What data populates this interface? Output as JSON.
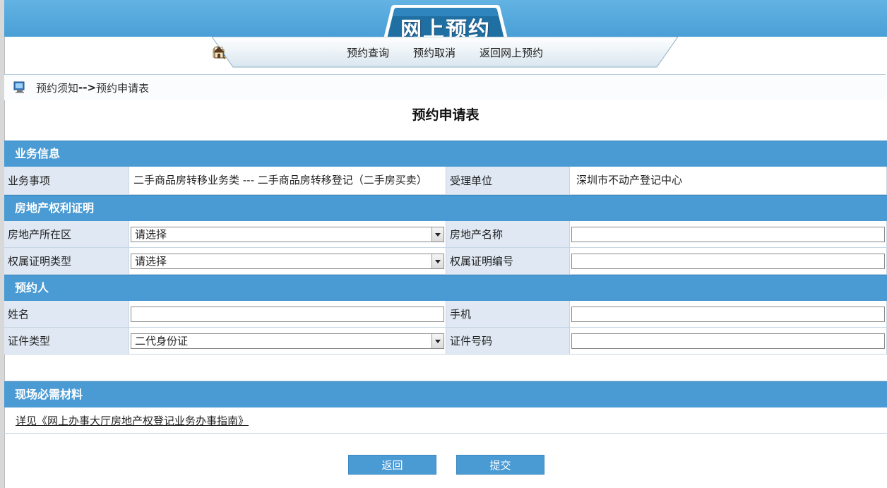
{
  "header": {
    "title": "网上预约",
    "nav": [
      {
        "icon": "search-icon",
        "label": "预约查询"
      },
      {
        "icon": "cancel-icon",
        "label": "预约取消"
      },
      {
        "icon": "home-icon",
        "label": "返回网上预约"
      }
    ]
  },
  "breadcrumb": {
    "parent": "预约须知",
    "separator": "-->",
    "current": "预约申请表"
  },
  "form_title": "预约申请表",
  "sections": {
    "business": {
      "title": "业务信息",
      "item_label": "业务事项",
      "item_value": "二手商品房转移业务类 --- 二手商品房转移登记（二手房买卖）",
      "office_label": "受理单位",
      "office_value": "深圳市不动产登记中心"
    },
    "property": {
      "title": "房地产权利证明",
      "district_label": "房地产所在区",
      "district_value": "请选择",
      "name_label": "房地产名称",
      "name_value": "",
      "cert_type_label": "权属证明类型",
      "cert_type_value": "请选择",
      "cert_no_label": "权属证明编号",
      "cert_no_value": ""
    },
    "person": {
      "title": "预约人",
      "name_label": "姓名",
      "name_value": "",
      "phone_label": "手机",
      "phone_value": "",
      "id_type_label": "证件类型",
      "id_type_value": "二代身份证",
      "id_no_label": "证件号码",
      "id_no_value": ""
    },
    "materials": {
      "title": "现场必需材料",
      "link": "详见《网上办事大厅房地产权登记业务办事指南》"
    }
  },
  "buttons": {
    "back": "返回",
    "submit": "提交"
  },
  "colors": {
    "accent": "#4a9ad3",
    "label_bg": "#dfe8f3",
    "header": "#5aaee0"
  }
}
